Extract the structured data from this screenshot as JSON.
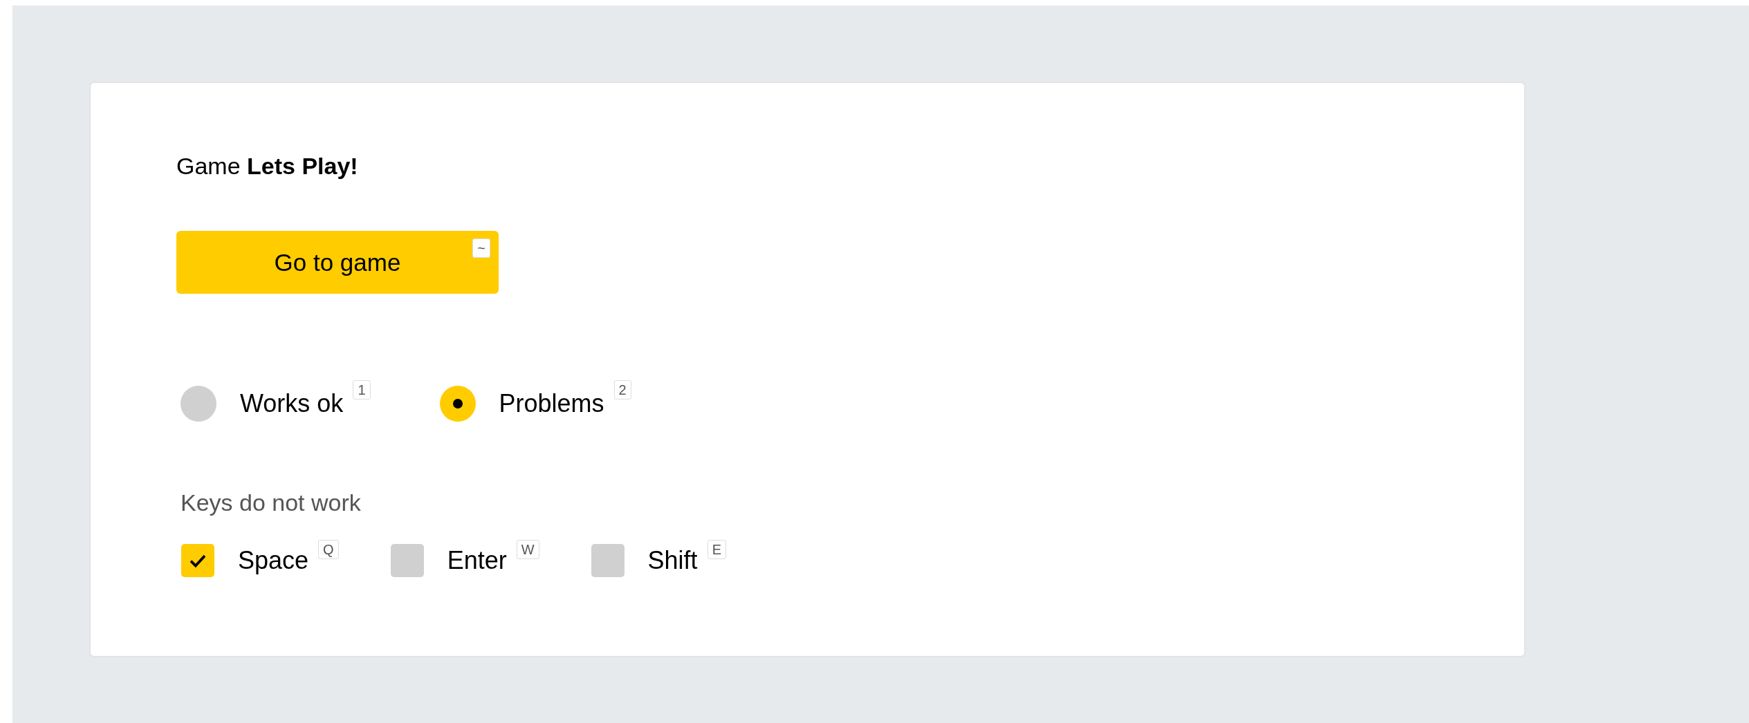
{
  "title": "Game **Lets Play!**",
  "button": {
    "label": "Go to game",
    "hotkey": "~"
  },
  "status": [
    {
      "label": "Works ok",
      "hotkey": "1",
      "selected": false
    },
    {
      "label": "Problems",
      "hotkey": "2",
      "selected": true
    }
  ],
  "keys_section": {
    "label": "Keys do not work",
    "keys": [
      {
        "label": "Space",
        "hotkey": "Q",
        "checked": true
      },
      {
        "label": "Enter",
        "hotkey": "W",
        "checked": false
      },
      {
        "label": "Shift",
        "hotkey": "E",
        "checked": false
      }
    ]
  }
}
